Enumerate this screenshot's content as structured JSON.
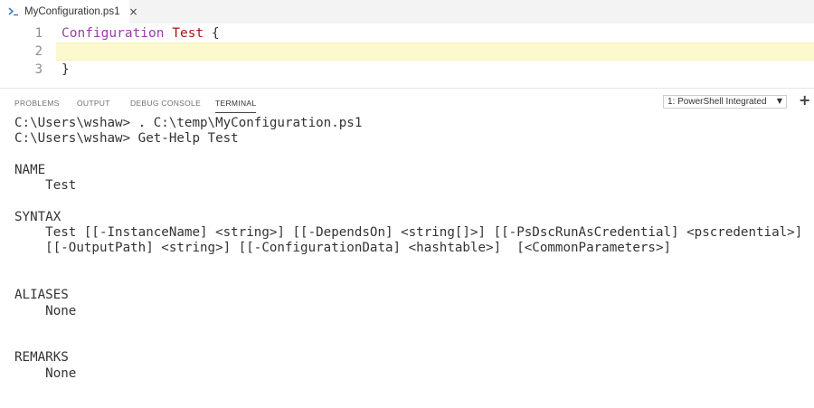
{
  "tab": {
    "filename": "MyConfiguration.ps1",
    "close_glyph": "×"
  },
  "editor": {
    "lines": [
      {
        "num": "1",
        "keyword": "Configuration",
        "name": "Test",
        "rest": " {"
      },
      {
        "num": "2",
        "text": ""
      },
      {
        "num": "3",
        "text": "}"
      }
    ]
  },
  "panel": {
    "tabs": [
      "PROBLEMS",
      "OUTPUT",
      "DEBUG CONSOLE",
      "TERMINAL"
    ],
    "active_tab": "TERMINAL",
    "terminal_selector": "1: PowerShell Integrated",
    "new_terminal_glyph": "+"
  },
  "terminal": {
    "lines": [
      "C:\\Users\\wshaw> . C:\\temp\\MyConfiguration.ps1",
      "C:\\Users\\wshaw> Get-Help Test",
      "",
      "NAME",
      "    Test",
      "",
      "SYNTAX",
      "    Test [[-InstanceName] <string>] [[-DependsOn] <string[]>] [[-PsDscRunAsCredential] <pscredential>]",
      "    [[-OutputPath] <string>] [[-ConfigurationData] <hashtable>]  [<CommonParameters>]",
      "",
      "",
      "ALIASES",
      "    None",
      "",
      "",
      "REMARKS",
      "    None"
    ]
  },
  "colors": {
    "keyword": "#9b3ea8",
    "name": "#a31515",
    "current_line": "#fcf9cf",
    "powershell_icon": "#3b78c2"
  }
}
